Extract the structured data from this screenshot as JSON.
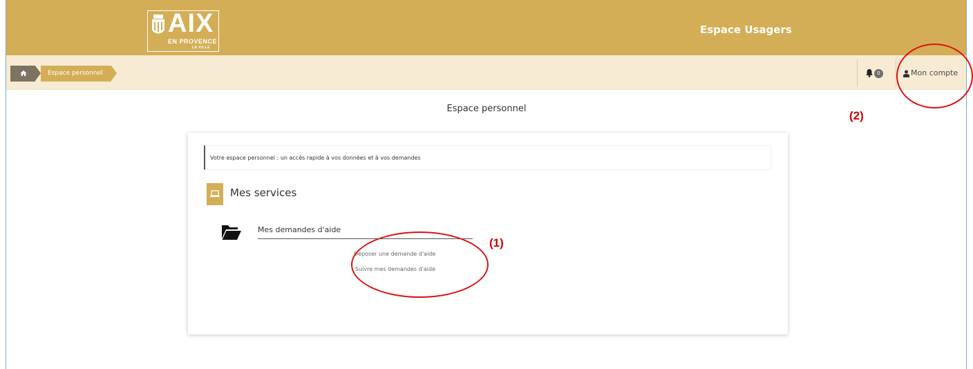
{
  "header": {
    "logo_text": "AIX",
    "logo_subtitle": "EN PROVENCE",
    "logo_tagline": "LA VILLE",
    "app_title": "Espace Usagers"
  },
  "breadcrumb": {
    "current": "Espace personnel"
  },
  "user_menu": {
    "notifications_count": "0",
    "account_label": "Mon compte"
  },
  "main": {
    "page_title": "Espace personnel",
    "intro_text": "Votre espace personnel : un accès rapide à vos données et à vos demandes",
    "services_title": "Mes services",
    "demandes_title": "Mes demandes d'aide",
    "links": {
      "deposer": "Déposer une demande d'aide",
      "suivre": "Suivre mes demandes d'aide"
    }
  },
  "annotations": {
    "marker_1": "(1)",
    "marker_2": "(2)",
    "color": "#cc0000"
  },
  "colors": {
    "brand_gold": "#d4ae56",
    "breadcrumb_bg": "#f7ecd3",
    "home_crumb": "#7d7361"
  }
}
